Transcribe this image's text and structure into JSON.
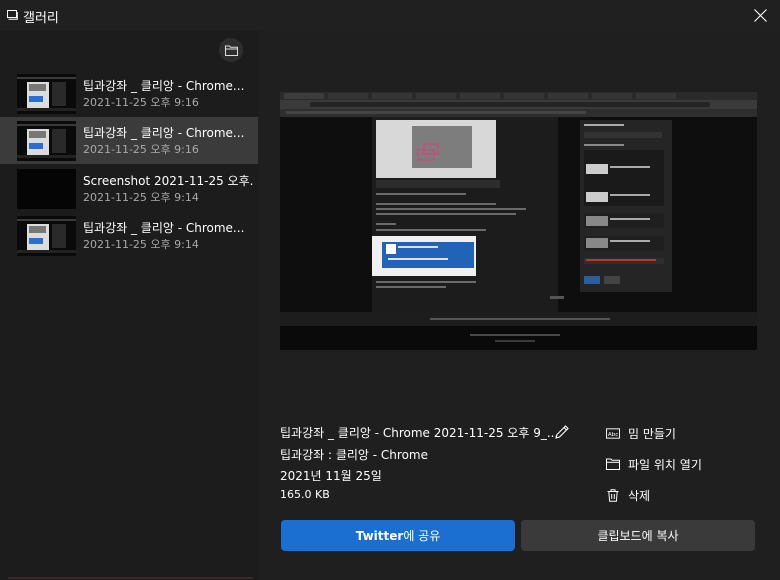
{
  "window": {
    "title": "갤러리",
    "app_icon": "gallery-icon",
    "close_icon": "close-icon"
  },
  "sidebar": {
    "folder_icon": "folder-icon",
    "items": [
      {
        "name": "팁과강좌 _ 클리앙 - Chrome...",
        "date": "2021-11-25 오후 9:16",
        "selected": false
      },
      {
        "name": "팁과강좌 _ 클리앙 - Chrome...",
        "date": "2021-11-25 오후 9:16",
        "selected": true
      },
      {
        "name": "Screenshot 2021-11-25 오후...",
        "date": "2021-11-25 오후 9:14",
        "selected": false
      },
      {
        "name": "팁과강좌 _ 클리앙 - Chrome...",
        "date": "2021-11-25 오후 9:14",
        "selected": false
      }
    ]
  },
  "details": {
    "file_name": "팁과강좌 _ 클리앙 - Chrome 2021-11-25 오후 9_...",
    "app_name": "팁과강좌 : 클리앙 - Chrome",
    "date": "2021년 11월 25일",
    "size": "165.0 KB"
  },
  "actions": {
    "meme": {
      "label": "밈 만들기",
      "icon": "meme-icon"
    },
    "open_location": {
      "label": "파일 위치 열기",
      "icon": "folder-icon"
    },
    "delete": {
      "label": "삭제",
      "icon": "trash-icon"
    }
  },
  "buttons": {
    "twitter_bold": "Twitter",
    "twitter_rest": "에 공유",
    "copy": "클립보드에 복사"
  },
  "colors": {
    "accent": "#1a6fd0",
    "selected_bg": "#3b3b3b",
    "panel_bg": "#1c1c1c",
    "main_bg": "#1f1f1f"
  }
}
